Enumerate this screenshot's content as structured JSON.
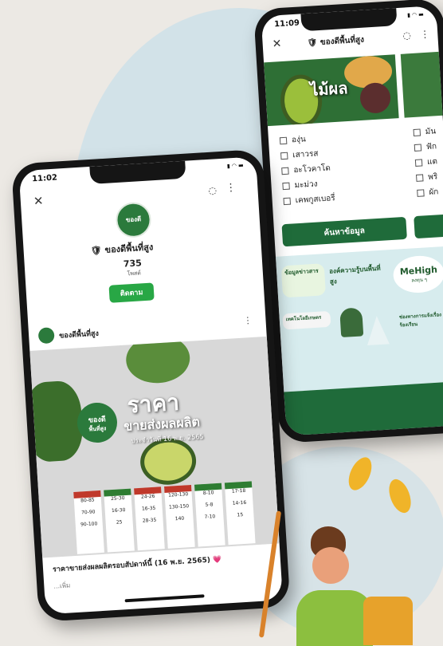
{
  "back_phone": {
    "status_time": "11:09",
    "status_icons": "▮ ◠ ▬",
    "page_title": "ของดีพื้นที่สูง",
    "banner_text": "ไม้ผล",
    "fruits_left": [
      "องุ่น",
      "เสาวรส",
      "อะโวคาโด",
      "มะม่วง",
      "เคพกูสเบอรี่"
    ],
    "fruits_right": [
      "มัน",
      "ฟัก",
      "แต",
      "พริ",
      "ผัก"
    ],
    "search_button": "ค้นหาข้อมูล",
    "promo": {
      "info_news": "ข้อมูลข่าวสาร",
      "knowledge": "องค์ความรู้บนพื้นที่สูง",
      "brand": "MeHigh",
      "brand_sub": "ลงทุน ๆ",
      "technology": "เทคโนโลยีเกษตร",
      "channel": "ช่องทางการแจ้งเรื่องร้องเรียน"
    }
  },
  "front_phone": {
    "status_time": "11:02",
    "status_icons": "▮ ◠ ▬",
    "profile_name": "ของดีพื้นที่สูง",
    "posts_count": "735",
    "posts_label": "โพสต์",
    "follow_button": "ติดตาม",
    "post_author": "ของดีพื้นที่สูง",
    "logo_text": "ของดี",
    "logo_sub": "พื้นที่สูง",
    "post_headline": "ราคา",
    "post_subheadline": "ขายส่งผลผลิต",
    "post_date_line": "ประจำวันที่ 16 พ.ย. 2565",
    "price_cards": [
      {
        "a": "80-85",
        "b": "70-90",
        "c": "90-100"
      },
      {
        "a": "25-30",
        "b": "16-30",
        "c": "25"
      },
      {
        "a": "24-26",
        "b": "16-35",
        "c": "28-35"
      },
      {
        "a": "120-130",
        "b": "130-150",
        "c": "140"
      },
      {
        "a": "8-10",
        "b": "5-8",
        "c": "7-10"
      },
      {
        "a": "17-18",
        "b": "14-16",
        "c": "15"
      }
    ],
    "caption": "ราคาขายส่งผลผลิตรอบสัปดาห์นี้ (16 พ.ย. 2565) 💗",
    "caption_more": "...เพิ่ม"
  }
}
